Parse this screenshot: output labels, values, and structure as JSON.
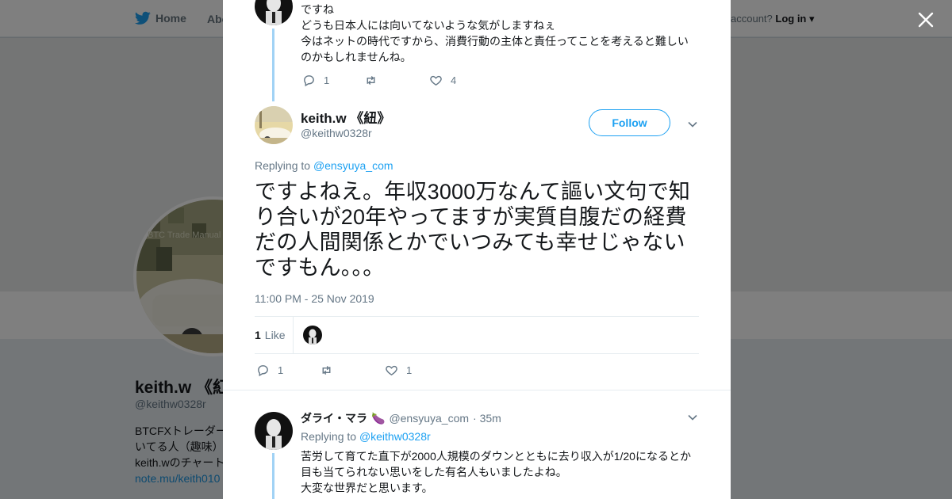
{
  "background": {
    "nav": {
      "home_label": "Home",
      "about_label": "Abo",
      "account_prompt": "account?",
      "login_label": "Log in"
    },
    "profile": {
      "name": "keith.w 《紅",
      "handle": "@keithw0328r",
      "bio_line1": "BTCFXトレーダー",
      "bio_line2": "いてる人（趣味）",
      "bio_line3": "keith.wのチャート",
      "bio_link": "note.mu/keith010",
      "avatar_watermark": "BTC Trade Manual"
    }
  },
  "modal": {
    "prev_tweet": {
      "lines": [
        "ですね",
        "どうも日本人には向いてないような気がしますねぇ",
        "今はネットの時代ですから、消費行動の主体と責任ってことを考えると難しい",
        "のかもしれませんね。"
      ],
      "reply_count": "1",
      "like_count": "4"
    },
    "main_tweet": {
      "name": "keith.w 《紐》",
      "handle": "@keithw0328r",
      "follow_label": "Follow",
      "replying_prefix": "Replying to",
      "replying_handle": "@ensyuya_com",
      "text": "ですよねえ。年収3000万なんて謳い文句で知り合いが20年やってますが実質自腹だの経費だの人間関係とかでいつみても幸せじゃないですもん。。。",
      "timestamp": "11:00 PM - 25 Nov 2019",
      "likes_count": "1",
      "likes_label": "Like",
      "reply_count": "1",
      "like_count": "1"
    },
    "reply_tweet": {
      "name": "ダライ・マラ",
      "emoji": "🍆",
      "handle": "@ensyuya_com",
      "time": "· 35m",
      "replying_prefix": "Replying to",
      "replying_handle": "@keithw0328r",
      "lines": [
        "苦労して育てた直下が2000人規模のダウンとともに去り収入が1/20になるとか",
        "目も当てられない思いをした有名人もいましたよね。",
        "大変な世界だと思います。"
      ]
    }
  },
  "colors": {
    "accent": "#1da1f2",
    "thread_line": "#a1d2f5",
    "muted": "#657786",
    "overlay": "rgba(0,0,0,0.5)"
  }
}
